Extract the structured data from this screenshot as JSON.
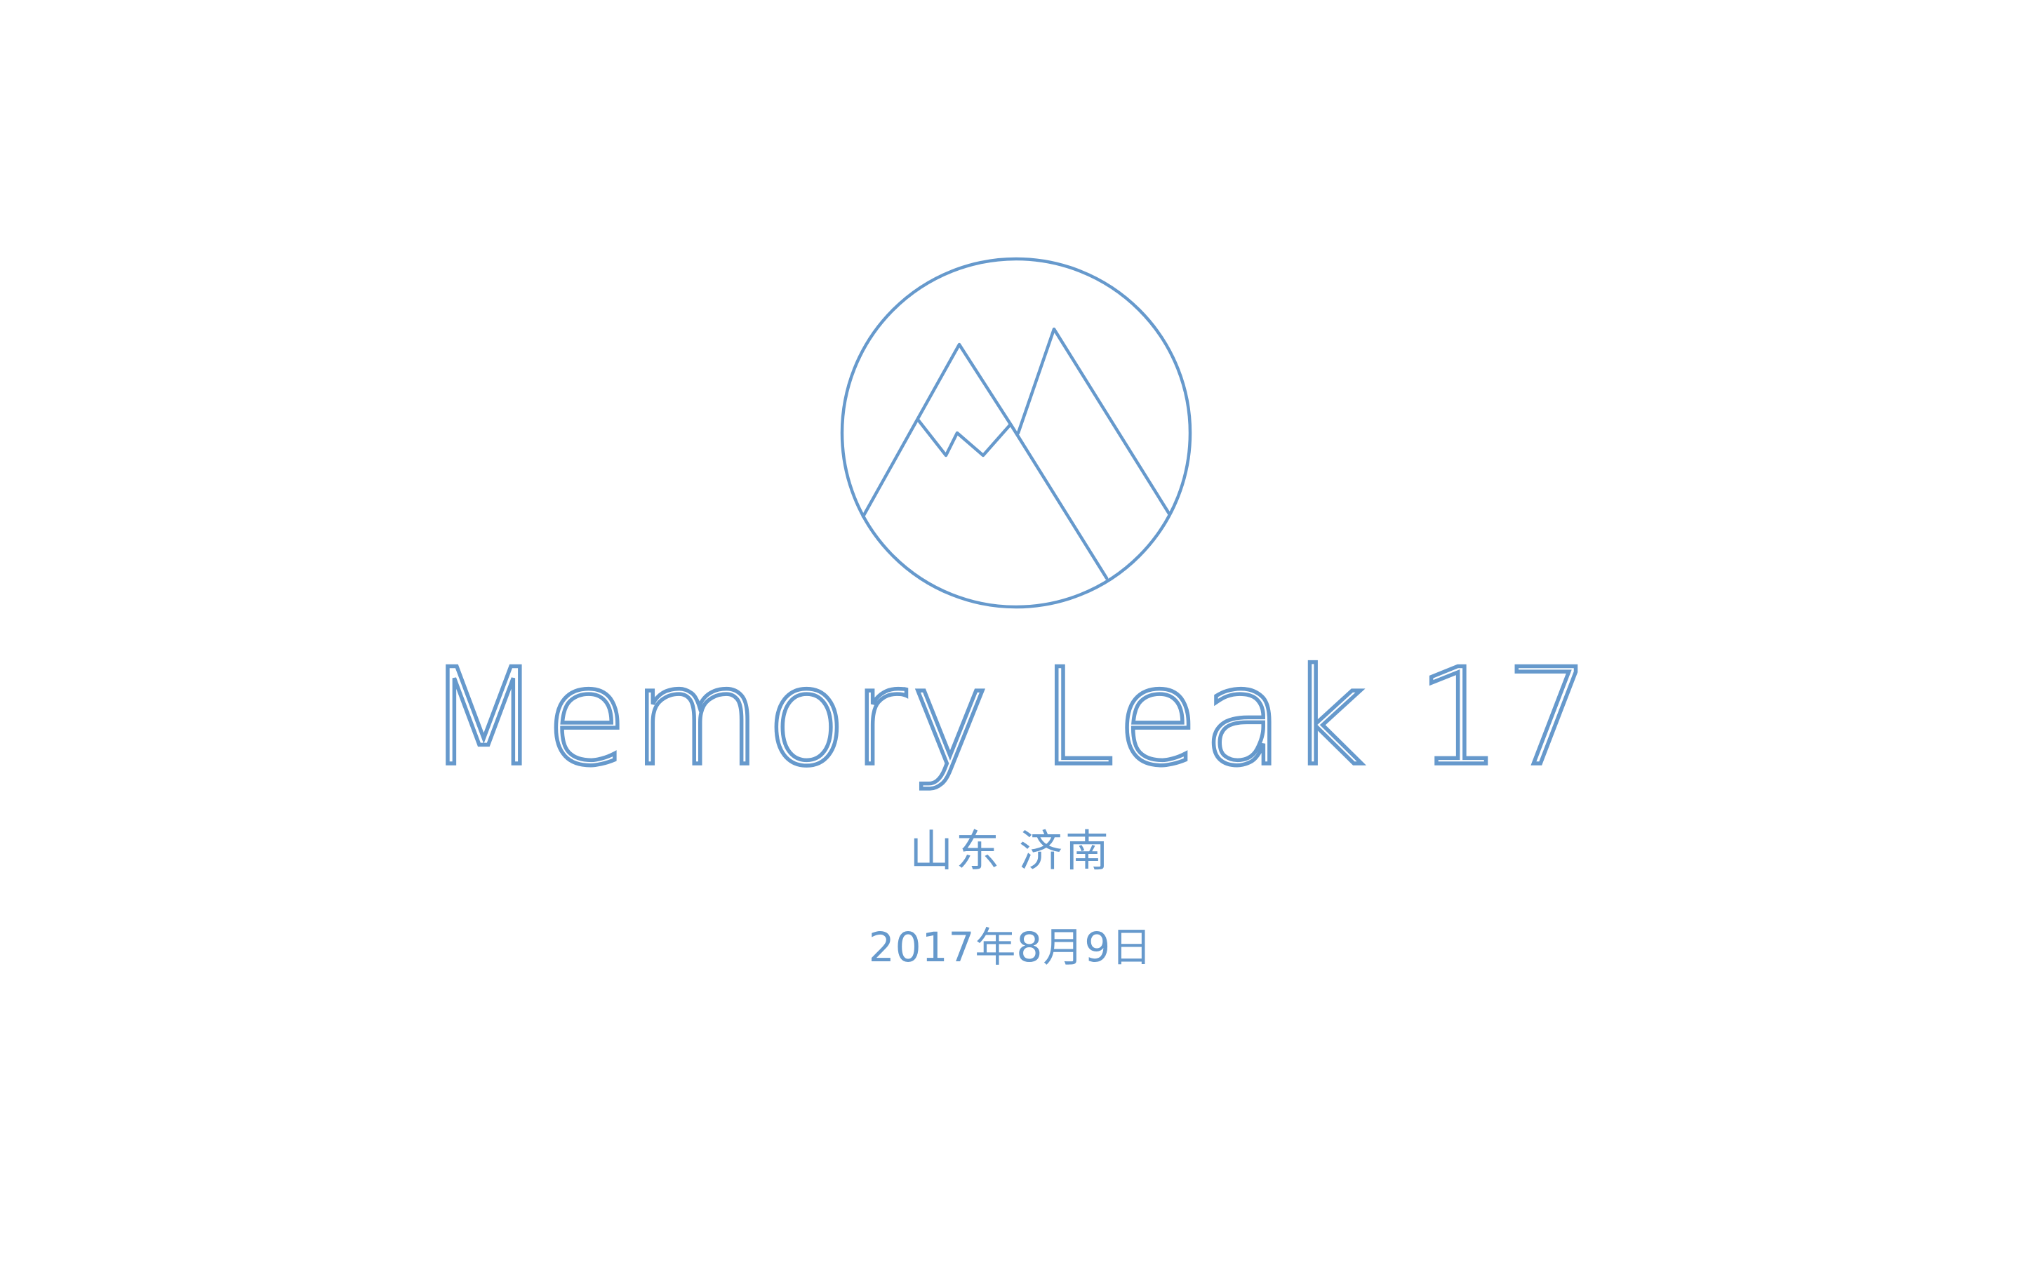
{
  "slide": {
    "title": "Memory Leak 17",
    "location": "山东 济南",
    "date": "2017年8月9日"
  },
  "logo": {
    "icon": "mountain-circle-icon"
  },
  "colors": {
    "accent": "#6699cc",
    "background": "#ffffff"
  }
}
